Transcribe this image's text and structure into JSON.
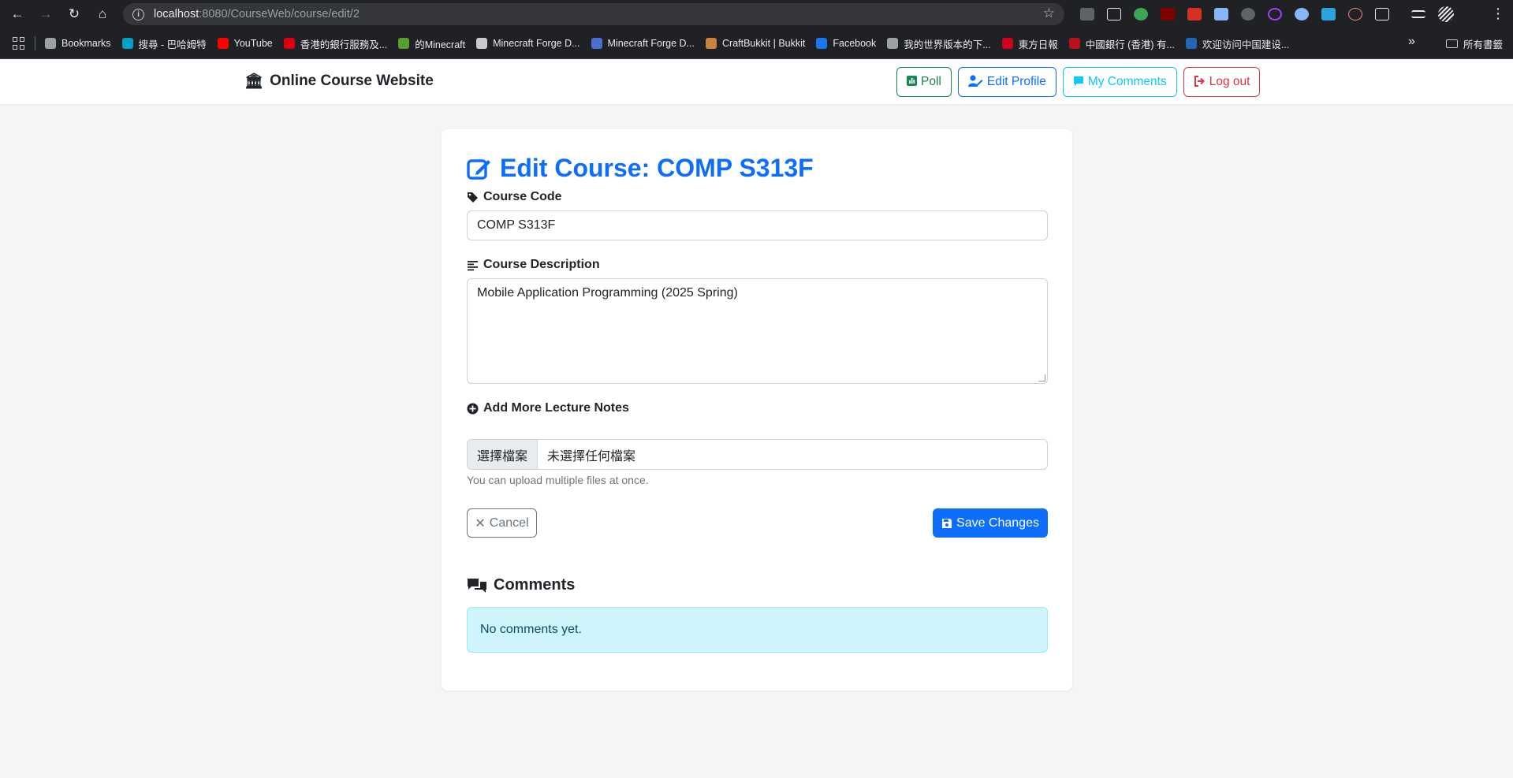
{
  "browser": {
    "url_host": "localhost",
    "url_path": ":8080/CourseWeb/course/edit/2",
    "bookmarks": [
      {
        "label": "Bookmarks",
        "icon": "star-icon",
        "color": "#9aa0a6"
      },
      {
        "label": "搜尋 - 巴哈姆特",
        "icon": "bahamut-icon",
        "color": "#00a0c8"
      },
      {
        "label": "YouTube",
        "icon": "youtube-icon",
        "color": "#ff0000"
      },
      {
        "label": "香港的銀行服務及...",
        "icon": "hsbc-icon",
        "color": "#db0011"
      },
      {
        "label": "的Minecraft",
        "icon": "minecraft-icon",
        "color": "#5a9e2d"
      },
      {
        "label": "Minecraft Forge D...",
        "icon": "forge-icon",
        "color": "#c9cacc"
      },
      {
        "label": "Minecraft Forge D...",
        "icon": "forge-icon",
        "color": "#4a6fd0"
      },
      {
        "label": "CraftBukkit | Bukkit",
        "icon": "bukkit-icon",
        "color": "#c8843a"
      },
      {
        "label": "Facebook",
        "icon": "facebook-icon",
        "color": "#1877f2"
      },
      {
        "label": "我的世界版本的下...",
        "icon": "image-icon",
        "color": "#9aa0a6"
      },
      {
        "label": "東方日報",
        "icon": "oriental-daily-icon",
        "color": "#d0021b"
      },
      {
        "label": "中國銀行 (香港) 有...",
        "icon": "boc-icon",
        "color": "#b5121b"
      },
      {
        "label": "欢迎访问中国建设...",
        "icon": "ccb-icon",
        "color": "#2465b8"
      }
    ],
    "all_bookmarks": "所有書籤"
  },
  "navbar": {
    "brand": "Online Course Website",
    "poll": "Poll",
    "edit_profile": "Edit Profile",
    "my_comments": "My Comments",
    "logout": "Log out"
  },
  "form": {
    "title": "Edit Course: COMP S313F",
    "code_label": "Course Code",
    "code_value": "COMP S313F",
    "desc_label": "Course Description",
    "desc_value": "Mobile Application Programming (2025 Spring)",
    "notes_label": "Add More Lecture Notes",
    "file_button": "選擇檔案",
    "file_status": "未選擇任何檔案",
    "help_text": "You can upload multiple files at once.",
    "cancel": "Cancel",
    "save": "Save Changes"
  },
  "comments": {
    "heading": "Comments",
    "empty": "No comments yet."
  },
  "colors": {
    "primary": "#0d6efd",
    "success": "#198754",
    "info": "#0dcaf0",
    "danger": "#dc3545",
    "alert_bg": "#cff4fc"
  }
}
